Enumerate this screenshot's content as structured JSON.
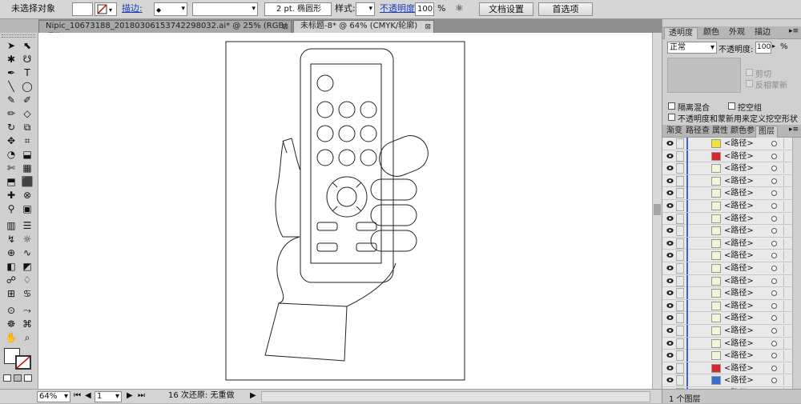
{
  "control_bar": {
    "selection_status": "未选择对象",
    "stroke_link": "描边:",
    "brush_value": "2 pt. 椭圆形",
    "style_label": "样式:",
    "opacity_link": "不透明度:",
    "opacity_value": "100",
    "opacity_unit": "%",
    "doc_setup_button": "文档设置",
    "preferences_button": "首选项"
  },
  "doc_tabs": [
    {
      "label": "Nipic_10673188_20180306153742298032.ai* @ 25% (RGB/预览)",
      "close": "⊠"
    },
    {
      "label": "未标题-8* @ 64% (CMYK/轮廓)",
      "close": "⊠"
    }
  ],
  "tools": [
    "➤",
    "⬉",
    "✱",
    "☋",
    "✒",
    "T",
    "╲",
    "◯",
    "✎",
    "✐",
    "✏",
    "◇",
    "↻",
    "⧉",
    "✥",
    "⌗",
    "◔",
    "⬓",
    "✄",
    "▦",
    "⬒",
    "⬛",
    "✚",
    "⊗",
    "⚲",
    "▣",
    "▥",
    "☰",
    "↯",
    "☼",
    "⊕",
    "∿",
    "◧",
    "◩",
    "☍",
    "♢",
    "⊞",
    "♋",
    "⊙",
    "⤳",
    "☸",
    "⌘",
    "✋",
    "⌕"
  ],
  "status_bar": {
    "zoom": "64%",
    "page": "1",
    "undo_status": "16 次还原: 无重做"
  },
  "transparency_panel": {
    "tabs": [
      "透明度",
      "颜色",
      "外观",
      "描边"
    ],
    "blend_mode": "正常",
    "opacity_label": "不透明度:",
    "opacity_value": "100",
    "opacity_unit": "%",
    "clip_label": "剪切",
    "invert_mask_label": "反相蒙新",
    "isolate_blend_label": "隔离混合",
    "knockout_group_label": "挖空组",
    "opacity_mask_label": "不透明度和蒙新用来定义挖空形状"
  },
  "layers_panel": {
    "tabs": [
      "渐变",
      "路径查",
      "属性",
      "颜色参",
      "图层"
    ],
    "rows": [
      {
        "name": "<路径>",
        "thumb": "#f2e33a"
      },
      {
        "name": "<路径>",
        "thumb": "#d9262e"
      },
      {
        "name": "<路径>",
        "thumb": "#f3f3d8"
      },
      {
        "name": "<路径>",
        "thumb": "#f3f3d8"
      },
      {
        "name": "<路径>",
        "thumb": "#f3f3d8"
      },
      {
        "name": "<路径>",
        "thumb": "#f3f3d8"
      },
      {
        "name": "<路径>",
        "thumb": "#f3f3d8"
      },
      {
        "name": "<路径>",
        "thumb": "#f3f3d8"
      },
      {
        "name": "<路径>",
        "thumb": "#f3f3d8"
      },
      {
        "name": "<路径>",
        "thumb": "#f3f3d8"
      },
      {
        "name": "<路径>",
        "thumb": "#f3f3d8"
      },
      {
        "name": "<路径>",
        "thumb": "#f3f3d8"
      },
      {
        "name": "<路径>",
        "thumb": "#f3f3d8"
      },
      {
        "name": "<路径>",
        "thumb": "#f3f3d8"
      },
      {
        "name": "<路径>",
        "thumb": "#f3f3d8"
      },
      {
        "name": "<路径>",
        "thumb": "#f3f3d8"
      },
      {
        "name": "<路径>",
        "thumb": "#f3f3d8"
      },
      {
        "name": "<路径>",
        "thumb": "#f3f3d8"
      },
      {
        "name": "<路径>",
        "thumb": "#d9262e"
      },
      {
        "name": "<路径>",
        "thumb": "#3a6fd0"
      },
      {
        "name": "<路径>",
        "thumb": "#3a6fd0"
      },
      {
        "name": "<路径>",
        "thumb": "#222222"
      }
    ],
    "footer_label": "1 个图层"
  }
}
